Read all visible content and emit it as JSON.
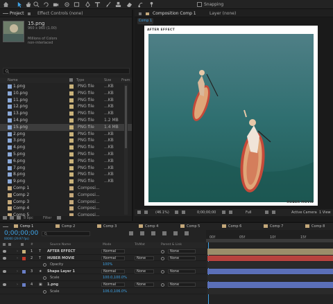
{
  "toolbar": {
    "tools": [
      "home-icon",
      "selection-tool-icon",
      "hand-tool-icon",
      "zoom-tool-icon",
      "rotate-tool-icon",
      "camera-tool-icon",
      "pan-behind-icon",
      "rectangle-tool-icon",
      "pen-tool-icon",
      "type-tool-icon",
      "brush-tool-icon",
      "clone-stamp-icon",
      "eraser-tool-icon",
      "roto-brush-icon",
      "puppet-pin-icon"
    ],
    "snapping_label": "Snapping"
  },
  "project_panel": {
    "tab_project": "Project",
    "tab_effect_controls": "Effect Controls (none)",
    "selected_item": {
      "name": "15.png",
      "dimensions": "960 x 960 (1.00)",
      "color_info": "Millions of Colors",
      "interlace": "non-interlaced"
    },
    "columns": [
      "Name",
      "Type",
      "Size",
      "Fram"
    ],
    "items": [
      {
        "name": "1.png",
        "type": "PNG file",
        "size": "...KB",
        "kind": "png"
      },
      {
        "name": "10.png",
        "type": "PNG file",
        "size": "...KB",
        "kind": "png"
      },
      {
        "name": "11.png",
        "type": "PNG file",
        "size": "...KB",
        "kind": "png"
      },
      {
        "name": "12.png",
        "type": "PNG file",
        "size": "...KB",
        "kind": "png"
      },
      {
        "name": "13.png",
        "type": "PNG file",
        "size": "...KB",
        "kind": "png"
      },
      {
        "name": "14.png",
        "type": "PNG file",
        "size": "1.2 MB",
        "kind": "png"
      },
      {
        "name": "15.png",
        "type": "PNG file",
        "size": "1.4 MB",
        "kind": "png",
        "selected": true
      },
      {
        "name": "2.png",
        "type": "PNG file",
        "size": "...KB",
        "kind": "png"
      },
      {
        "name": "3.png",
        "type": "PNG file",
        "size": "...KB",
        "kind": "png"
      },
      {
        "name": "4.png",
        "type": "PNG file",
        "size": "...KB",
        "kind": "png"
      },
      {
        "name": "5.png",
        "type": "PNG file",
        "size": "...KB",
        "kind": "png"
      },
      {
        "name": "6.png",
        "type": "PNG file",
        "size": "...KB",
        "kind": "png"
      },
      {
        "name": "7.png",
        "type": "PNG file",
        "size": "...KB",
        "kind": "png"
      },
      {
        "name": "8.png",
        "type": "PNG file",
        "size": "...KB",
        "kind": "png"
      },
      {
        "name": "9.png",
        "type": "PNG file",
        "size": "...KB",
        "kind": "png"
      },
      {
        "name": "Comp 1",
        "type": "Composi...",
        "size": "",
        "kind": "comp"
      },
      {
        "name": "Comp 2",
        "type": "Composi...",
        "size": "",
        "kind": "comp"
      },
      {
        "name": "Comp 3",
        "type": "Composi...",
        "size": "",
        "kind": "comp"
      },
      {
        "name": "Comp 4",
        "type": "Composi...",
        "size": "",
        "kind": "comp"
      },
      {
        "name": "Comp 5",
        "type": "Composi...",
        "size": "",
        "kind": "comp"
      }
    ],
    "bottom": {
      "bpc": "8 bpc",
      "filter": "Filter"
    }
  },
  "composition_panel": {
    "tab_label": "Composition Comp 1",
    "layer_tab": "Layer (none)",
    "comp_chip": "Comp 1",
    "artboard": {
      "top_text": "AFTER EFFECT",
      "bottom_text": "HUBER MOVIE"
    },
    "controls": {
      "zoom": "(46.1%)",
      "timecode": "0;00;00;00",
      "resolution": "Full",
      "camera": "Active Camera",
      "views": "1 View"
    }
  },
  "timeline": {
    "tabs": [
      "Comp 1",
      "Comp 2",
      "Comp 3",
      "Comp 4",
      "Comp 5",
      "Comp 6",
      "Comp 7",
      "Comp 8"
    ],
    "timecode": "0;00;00;00",
    "frames_text": "00000 (29.97 fps)",
    "headers": {
      "source": "Source Name",
      "mode": "Mode",
      "trkmat": "TrkMat",
      "parent": "Parent & Link"
    },
    "layers": [
      {
        "num": "1",
        "name": "AFTER EFFECT",
        "mode": "Normal",
        "trkmat": "",
        "parent": "None",
        "kind": "text",
        "color": "#c9b27a"
      },
      {
        "num": "2",
        "name": "HUBER MOVIE",
        "mode": "Normal",
        "trkmat": "None",
        "parent": "None",
        "kind": "text",
        "color": "#c0392b"
      },
      {
        "num": "3",
        "name": "Shape Layer 1",
        "mode": "Normal",
        "trkmat": "None",
        "parent": "None",
        "kind": "shape",
        "color": "#6a7fc7"
      },
      {
        "num": "4",
        "name": "1.png",
        "mode": "Normal",
        "trkmat": "None",
        "parent": "None",
        "kind": "footage",
        "color": "#6a7fc7"
      }
    ],
    "properties": {
      "opacity_label": "Opacity",
      "opacity_value": "100%",
      "scale_label": "Scale",
      "scale_value_3": "100.0,100.0%",
      "scale_value_4": "106.0,106.0%"
    },
    "ruler_labels": [
      "00f",
      "05f",
      "10f",
      "15f"
    ],
    "colors": {
      "accent": "#3fa4e8",
      "layer_red": "#b8423e",
      "layer_blue": "#5b6fb8",
      "layer_tan": "#9b8d6a"
    }
  }
}
